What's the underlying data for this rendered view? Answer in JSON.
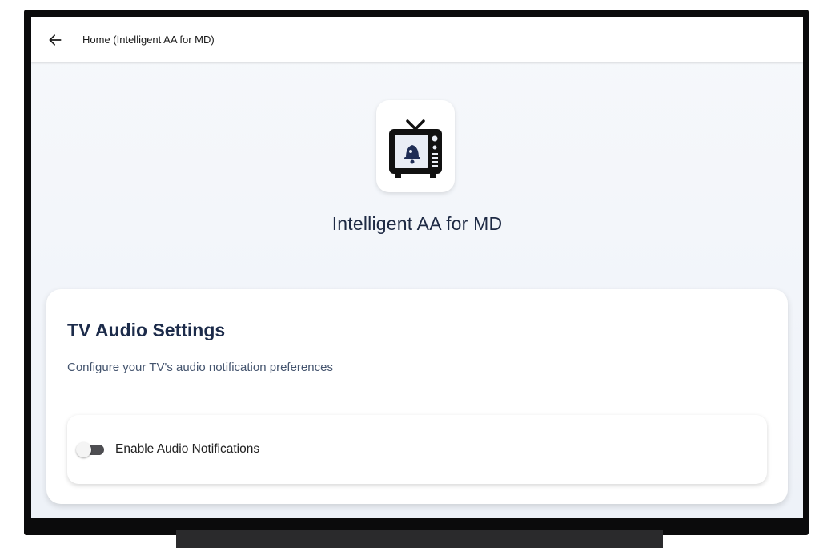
{
  "header": {
    "title": "Home (Intelligent AA for MD)",
    "back_icon": "arrow-left-icon"
  },
  "app": {
    "name": "Intelligent AA for MD",
    "icon": "tv-bell-icon"
  },
  "settings_card": {
    "title": "TV Audio Settings",
    "subtitle": "Configure your TV's audio notification preferences",
    "toggle": {
      "label": "Enable Audio Notifications",
      "checked": false
    }
  },
  "colors": {
    "title_text": "#1c2b4a",
    "icon_accent": "#1f2d55"
  }
}
